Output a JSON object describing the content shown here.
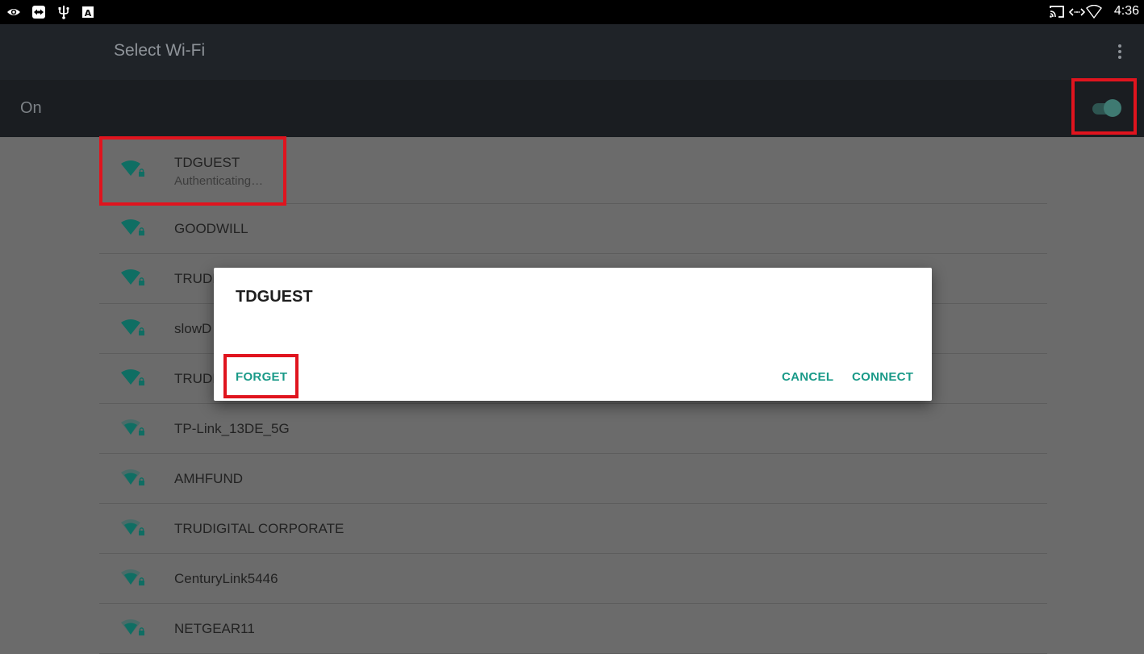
{
  "status_bar": {
    "time": "4:36",
    "left_icons": [
      "eye-icon",
      "teamviewer-icon",
      "usb-icon",
      "a-notification-icon"
    ],
    "right_icons": [
      "cast-icon",
      "data-transfer-icon",
      "wifi-status-icon"
    ]
  },
  "app_bar": {
    "title": "Select Wi-Fi",
    "menu_icon": "overflow-menu-icon"
  },
  "wifi_toggle": {
    "label": "On",
    "state": "on"
  },
  "networks": [
    {
      "ssid": "TDGUEST",
      "status": "Authenticating…"
    },
    {
      "ssid": "GOODWILL",
      "status": ""
    },
    {
      "ssid": "TRUDI",
      "status": ""
    },
    {
      "ssid": "slowD",
      "status": ""
    },
    {
      "ssid": "TRUDI",
      "status": ""
    },
    {
      "ssid": "TP-Link_13DE_5G",
      "status": ""
    },
    {
      "ssid": "AMHFUND",
      "status": ""
    },
    {
      "ssid": "TRUDIGITAL CORPORATE",
      "status": ""
    },
    {
      "ssid": "CenturyLink5446",
      "status": ""
    },
    {
      "ssid": "NETGEAR11",
      "status": ""
    }
  ],
  "dialog": {
    "title": "TDGUEST",
    "forget_label": "FORGET",
    "cancel_label": "CANCEL",
    "connect_label": "CONNECT"
  },
  "colors": {
    "accent": "#1a9a88",
    "wifi_icon": "#0f6e63",
    "highlight": "#e0141e",
    "app_bar": "#1f2328",
    "scrim": "#6b6b6b"
  }
}
